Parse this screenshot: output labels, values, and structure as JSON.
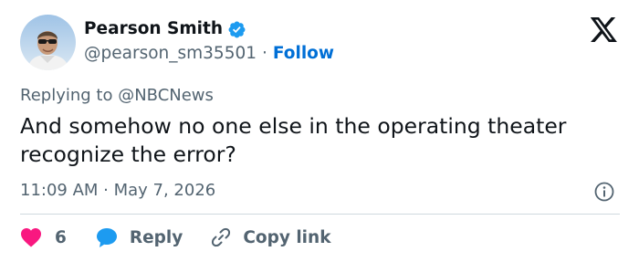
{
  "author": {
    "name": "Pearson Smith",
    "handle": "@pearson_sm35501",
    "separator": "·",
    "follow_label": "Follow",
    "verified": true
  },
  "reply_context": {
    "text": "Replying to @NBCNews"
  },
  "tweet": {
    "text": "And somehow no one else in the operating theater recognize the error?",
    "timestamp": "11:09 AM · May 7, 2026"
  },
  "actions": {
    "like_count": "6",
    "reply_label": "Reply",
    "copy_link_label": "Copy link"
  },
  "icons": {
    "brand": "x-logo-icon",
    "verified": "verified-badge-icon",
    "info": "info-icon",
    "like": "heart-icon",
    "reply": "speech-bubble-icon",
    "copy": "link-icon"
  },
  "colors": {
    "text_primary": "#0f1419",
    "text_secondary": "#536471",
    "link_blue": "#006fd6",
    "verified_blue": "#1d9bf0",
    "heart_pink": "#f91880",
    "divider": "#cfd9de"
  }
}
